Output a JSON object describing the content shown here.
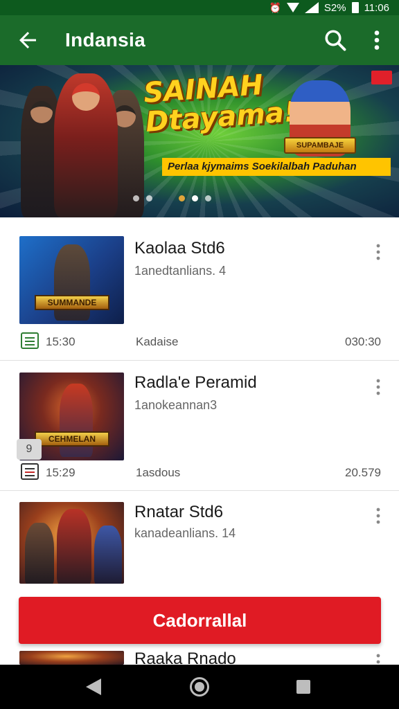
{
  "status_bar": {
    "battery_text": "S2%",
    "time": "11:06"
  },
  "app_bar": {
    "title": "Indansia",
    "icons": [
      "arrow-back-icon",
      "search-icon",
      "more-vert-icon"
    ]
  },
  "banner": {
    "headline_line1": "SAINAH",
    "headline_line2": "Dtayama!",
    "tagline": "Perlaa kjymaims Soekilalbah Paduhan",
    "game_logo_text": "SUPAMBAJE",
    "carousel_pages": 5,
    "active_page": 3
  },
  "items": [
    {
      "title": "Kaolaa Std6",
      "subtitle": "1anedtanlians. 4",
      "thumb_logo": "SUMMANDE",
      "time": "15:30",
      "category": "Kadaise",
      "code": "030:30"
    },
    {
      "title": "Radla'e Peramid",
      "subtitle": "1anokeannan3",
      "thumb_logo": "CEHMELAN",
      "overlay_badge": "9",
      "time": "15:29",
      "category": "1asdous",
      "code": "20.579"
    },
    {
      "title": "Rnatar Std6",
      "subtitle": "kanadeanlians. 14",
      "thumb_logo": ""
    },
    {
      "title": "Raaka Rnado"
    }
  ],
  "cta": {
    "label": "Cadorrallal"
  },
  "colors": {
    "app_bar": "#1b6b2a",
    "status_bar": "#0d5a1e",
    "cta": "#e01b24",
    "nav_bar": "#000000"
  }
}
